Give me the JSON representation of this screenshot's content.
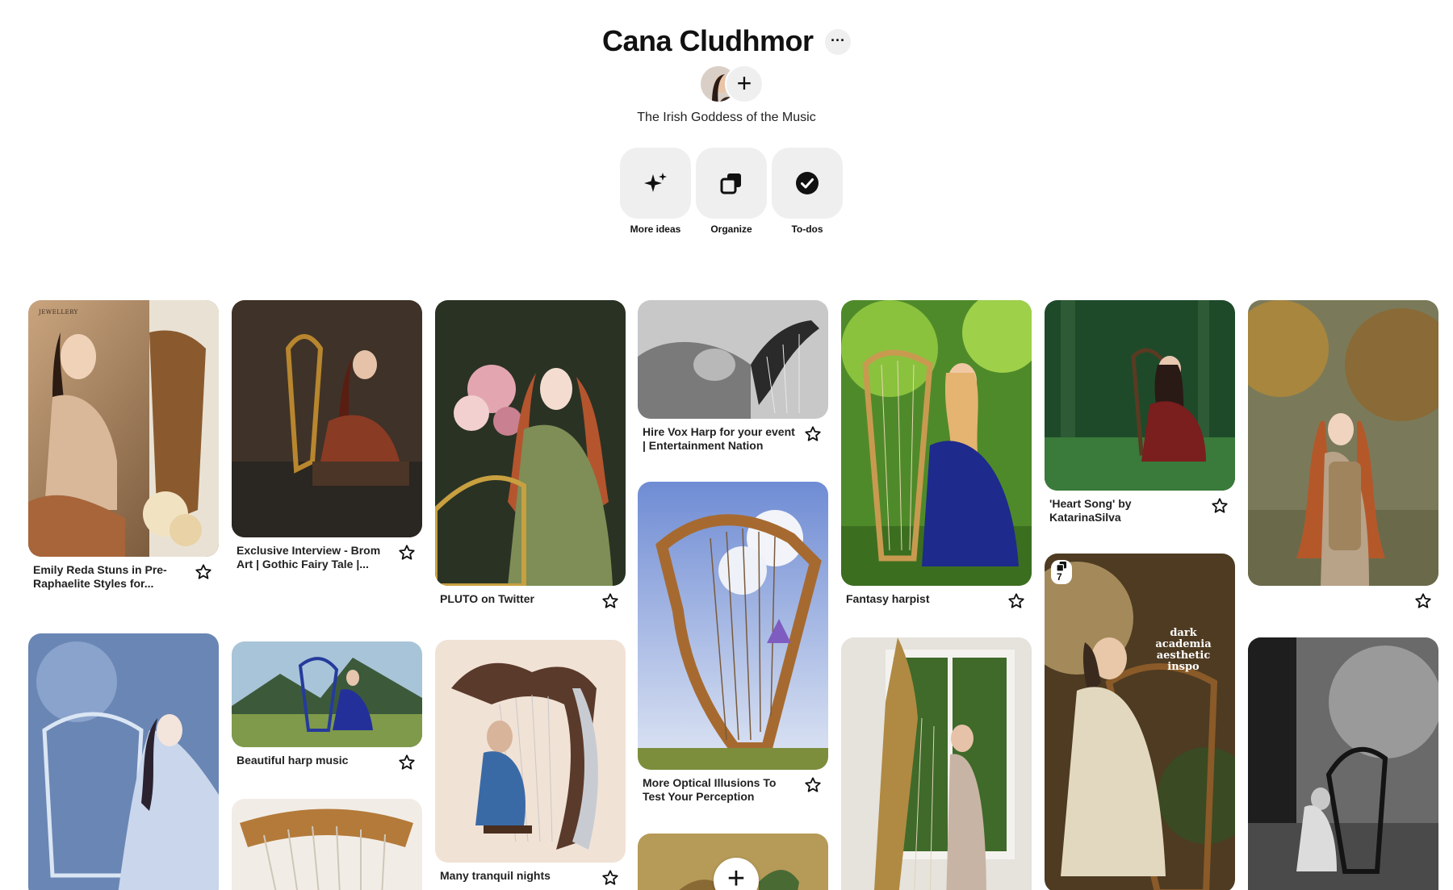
{
  "board": {
    "title": "Cana Cludhmor",
    "more_label": "···",
    "add_label": "+",
    "description": "The Irish Goddess of the Music"
  },
  "actions": [
    {
      "label": "More ideas",
      "icon": "sparkle-icon"
    },
    {
      "label": "Organize",
      "icon": "organize-icon"
    },
    {
      "label": "To-dos",
      "icon": "checkmark-icon"
    }
  ],
  "pins": [
    {
      "caption": "Emily Reda Stuns in Pre-Raphaelite Styles for...",
      "icon": "star-icon",
      "corner_text": "JEWELLERY"
    },
    {
      "caption": "Exclusive Interview - Brom Art | Gothic Fairy Tale |...",
      "icon": "star-icon"
    },
    {
      "caption": "PLUTO on Twitter",
      "icon": "star-icon"
    },
    {
      "caption": "Hire Vox Harp for your event | Entertainment Nation",
      "icon": "star-icon"
    },
    {
      "caption": "More Optical Illusions To Test Your Perception",
      "icon": "star-icon"
    },
    {
      "caption": "Fantasy harpist",
      "icon": "star-icon"
    },
    {
      "caption": "'Heart Song' by KatarinaSilva",
      "icon": "star-icon"
    },
    {
      "caption": "",
      "icon": "star-icon"
    },
    {
      "caption": "Beautiful harp music",
      "icon": "star-icon"
    },
    {
      "caption": "Many tranquil nights",
      "icon": "star-icon"
    },
    {
      "badge": "7",
      "overlay": "dark academia aesthetic inspo"
    },
    {
      "add_label": "+"
    }
  ],
  "colors": {
    "background": "#ffffff",
    "button_bg": "#efefef",
    "text": "#111111"
  }
}
